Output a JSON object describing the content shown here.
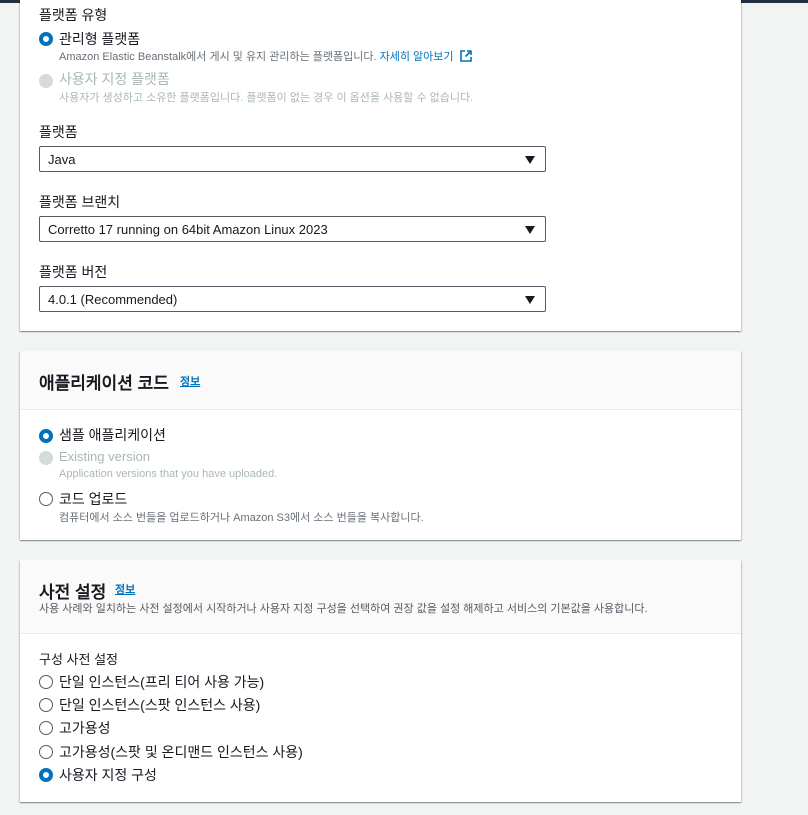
{
  "platform_section": {
    "platform_type_label": "플랫폼 유형",
    "managed": {
      "label": "관리형 플랫폼",
      "desc": "Amazon Elastic Beanstalk에서 게시 및 유지 관리하는 플랫폼입니다.",
      "link": "자세히 알아보기"
    },
    "custom": {
      "label": "사용자 지정 플랫폼",
      "desc": "사용자가 생성하고 소유한 플랫폼입니다. 플랫폼이 없는 경우 이 옵션을 사용할 수 없습니다."
    },
    "platform_label": "플랫폼",
    "platform_value": "Java",
    "branch_label": "플랫폼 브랜치",
    "branch_value": "Corretto 17 running on 64bit Amazon Linux 2023",
    "version_label": "플랫폼 버전",
    "version_value": "4.0.1 (Recommended)"
  },
  "app_code": {
    "title": "애플리케이션 코드",
    "info": "정보",
    "sample": {
      "label": "샘플 애플리케이션"
    },
    "existing": {
      "label": "Existing version",
      "desc": "Application versions that you have uploaded."
    },
    "upload": {
      "label": "코드 업로드",
      "desc": "컴퓨터에서 소스 번들을 업로드하거나 Amazon S3에서 소스 번들을 복사합니다."
    }
  },
  "presets": {
    "title": "사전 설정",
    "info": "정보",
    "desc": "사용 사례와 일치하는 사전 설정에서 시작하거나 사용자 지정 구성을 선택하여 권장 값을 설정 해제하고 서비스의 기본값을 사용합니다.",
    "group_label": "구성 사전 설정",
    "options": [
      "단일 인스턴스(프리 티어 사용 가능)",
      "단일 인스턴스(스팟 인스턴스 사용)",
      "고가용성",
      "고가용성(스팟 및 온디맨드 인스턴스 사용)",
      "사용자 지정 구성"
    ]
  },
  "colors": {
    "accent": "#0073bb",
    "background": "#f2f3f3"
  }
}
